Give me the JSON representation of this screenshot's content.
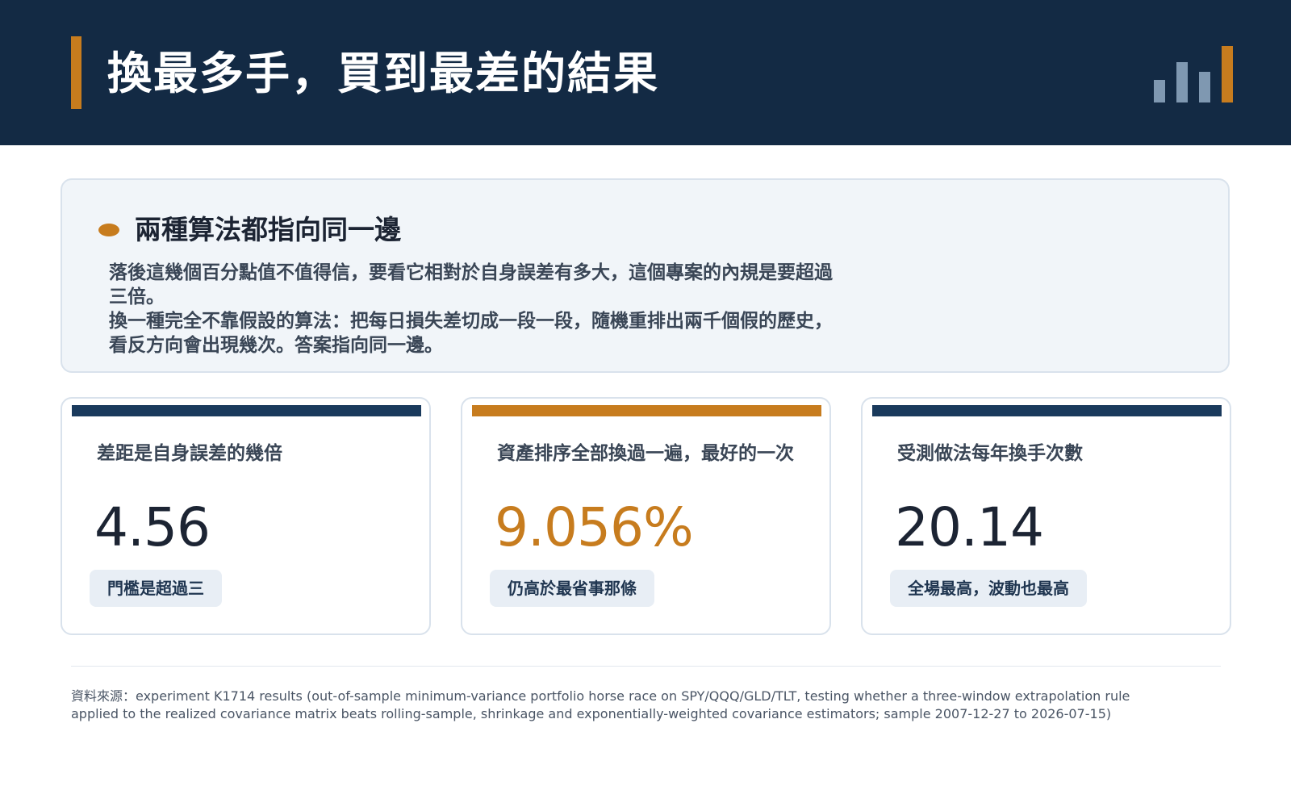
{
  "header": {
    "title": "換最多手，買到最差的結果",
    "logo_icon": "bar-chart-logo",
    "colors": {
      "background": "#132a44",
      "accent": "#c77c1e",
      "logo_bars_muted": "#7f98b1"
    }
  },
  "info": {
    "heading": "兩種算法都指向同一邊",
    "paragraphs": [
      "落後這幾個百分點值不值得信，要看它相對於自身誤差有多大，這個專案的內規是要超過三倍。",
      "換一種完全不靠假設的算法：把每日損失差切成一段一段，隨機重排出兩千個假的歷史，看反方向會出現幾次。答案指向同一邊。"
    ]
  },
  "cards": [
    {
      "label": "差距是自身誤差的幾倍",
      "value": "4.56",
      "badge": "門檻是超過三",
      "accent_color": "#1a3a5c",
      "value_color": "#1c2433"
    },
    {
      "label": "資產排序全部換過一遍，最好的一次",
      "value": "9.056%",
      "badge": "仍高於最省事那條",
      "accent_color": "#c77c1e",
      "value_color": "#c77c1e"
    },
    {
      "label": "受測做法每年換手次數",
      "value": "20.14",
      "badge": "全場最高，波動也最高",
      "accent_color": "#1a3a5c",
      "value_color": "#1c2433"
    }
  ],
  "footer": {
    "source": "資料來源：experiment K1714 results (out-of-sample minimum-variance portfolio horse race on SPY/QQQ/GLD/TLT, testing whether a three-window extrapolation rule applied to the realized covariance matrix beats rolling-sample, shrinkage and exponentially-weighted covariance estimators; sample 2007-12-27 to 2026-07-15)"
  }
}
